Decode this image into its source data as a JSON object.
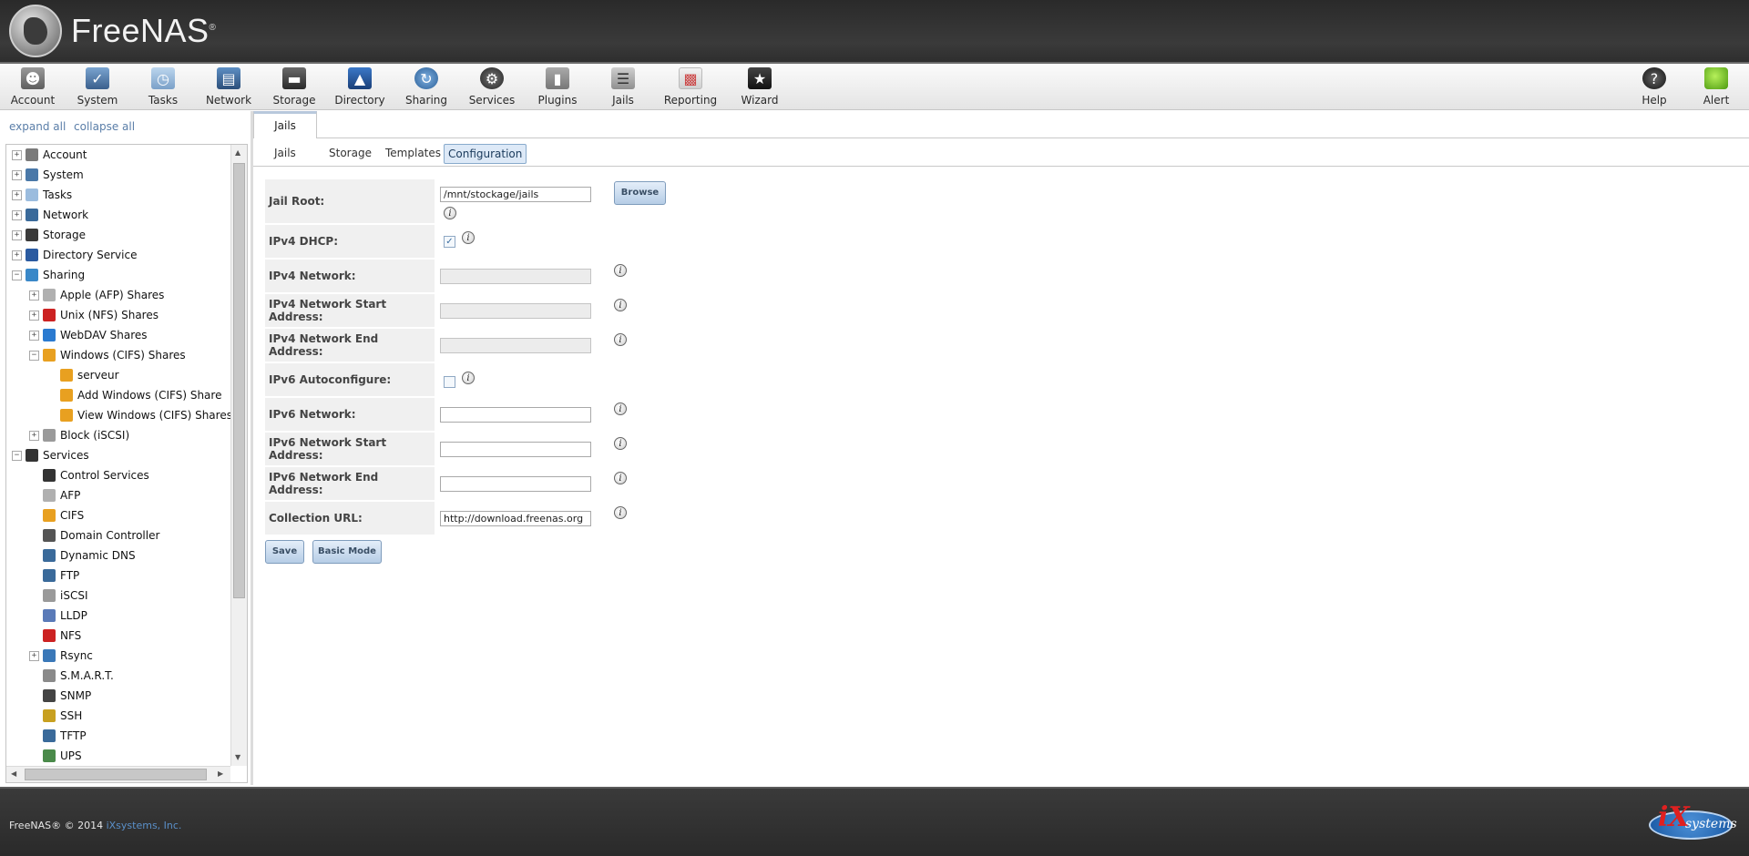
{
  "brand": {
    "name": "FreeNAS",
    "reg": "®"
  },
  "toolbar": {
    "items": [
      {
        "label": "Account",
        "icon": "account-icon"
      },
      {
        "label": "System",
        "icon": "system-icon"
      },
      {
        "label": "Tasks",
        "icon": "tasks-icon"
      },
      {
        "label": "Network",
        "icon": "network-icon"
      },
      {
        "label": "Storage",
        "icon": "storage-icon"
      },
      {
        "label": "Directory",
        "icon": "directory-icon"
      },
      {
        "label": "Sharing",
        "icon": "sharing-icon"
      },
      {
        "label": "Services",
        "icon": "services-icon"
      },
      {
        "label": "Plugins",
        "icon": "plugins-icon"
      },
      {
        "label": "Jails",
        "icon": "jails-icon"
      },
      {
        "label": "Reporting",
        "icon": "reporting-icon"
      },
      {
        "label": "Wizard",
        "icon": "wizard-icon"
      }
    ],
    "right": [
      {
        "label": "Help",
        "icon": "help-icon"
      },
      {
        "label": "Alert",
        "icon": "alert-icon"
      }
    ]
  },
  "tree_controls": {
    "expand": "expand all",
    "collapse": "collapse all"
  },
  "tree": [
    {
      "label": "Account",
      "level": 0,
      "toggle": "+",
      "icon": "account-icon"
    },
    {
      "label": "System",
      "level": 0,
      "toggle": "+",
      "icon": "system-icon"
    },
    {
      "label": "Tasks",
      "level": 0,
      "toggle": "+",
      "icon": "tasks-icon"
    },
    {
      "label": "Network",
      "level": 0,
      "toggle": "+",
      "icon": "network-icon"
    },
    {
      "label": "Storage",
      "level": 0,
      "toggle": "+",
      "icon": "storage-icon"
    },
    {
      "label": "Directory Service",
      "level": 0,
      "toggle": "+",
      "icon": "directory-icon"
    },
    {
      "label": "Sharing",
      "level": 0,
      "toggle": "−",
      "icon": "sharing-icon"
    },
    {
      "label": "Apple (AFP) Shares",
      "level": 1,
      "toggle": "+",
      "icon": "apple-icon"
    },
    {
      "label": "Unix (NFS) Shares",
      "level": 1,
      "toggle": "+",
      "icon": "nfs-icon"
    },
    {
      "label": "WebDAV Shares",
      "level": 1,
      "toggle": "+",
      "icon": "webdav-icon"
    },
    {
      "label": "Windows (CIFS) Shares",
      "level": 1,
      "toggle": "−",
      "icon": "windows-icon"
    },
    {
      "label": "serveur",
      "level": 2,
      "toggle": "",
      "icon": "windows-icon"
    },
    {
      "label": "Add Windows (CIFS) Share",
      "level": 2,
      "toggle": "",
      "icon": "add-share-icon"
    },
    {
      "label": "View Windows (CIFS) Shares",
      "level": 2,
      "toggle": "",
      "icon": "view-shares-icon"
    },
    {
      "label": "Block (iSCSI)",
      "level": 1,
      "toggle": "+",
      "icon": "block-icon"
    },
    {
      "label": "Services",
      "level": 0,
      "toggle": "−",
      "icon": "services-icon"
    },
    {
      "label": "Control Services",
      "level": 1,
      "toggle": "",
      "icon": "services-icon"
    },
    {
      "label": "AFP",
      "level": 1,
      "toggle": "",
      "icon": "apple-icon"
    },
    {
      "label": "CIFS",
      "level": 1,
      "toggle": "",
      "icon": "windows-icon"
    },
    {
      "label": "Domain Controller",
      "level": 1,
      "toggle": "",
      "icon": "domain-controller-icon"
    },
    {
      "label": "Dynamic DNS",
      "level": 1,
      "toggle": "",
      "icon": "network-icon"
    },
    {
      "label": "FTP",
      "level": 1,
      "toggle": "",
      "icon": "ftp-icon"
    },
    {
      "label": "iSCSI",
      "level": 1,
      "toggle": "",
      "icon": "block-icon"
    },
    {
      "label": "LLDP",
      "level": 1,
      "toggle": "",
      "icon": "lldp-icon"
    },
    {
      "label": "NFS",
      "level": 1,
      "toggle": "",
      "icon": "nfs-icon"
    },
    {
      "label": "Rsync",
      "level": 1,
      "toggle": "+",
      "icon": "rsync-icon"
    },
    {
      "label": "S.M.A.R.T.",
      "level": 1,
      "toggle": "",
      "icon": "smart-icon"
    },
    {
      "label": "SNMP",
      "level": 1,
      "toggle": "",
      "icon": "snmp-icon"
    },
    {
      "label": "SSH",
      "level": 1,
      "toggle": "",
      "icon": "ssh-icon"
    },
    {
      "label": "TFTP",
      "level": 1,
      "toggle": "",
      "icon": "tftp-icon"
    },
    {
      "label": "UPS",
      "level": 1,
      "toggle": "",
      "icon": "ups-icon"
    }
  ],
  "main": {
    "top_tab": "Jails",
    "subtabs": [
      "Jails",
      "Storage",
      "Templates",
      "Configuration"
    ],
    "active_subtab": "Configuration",
    "form": {
      "jail_root": {
        "label": "Jail Root:",
        "value": "/mnt/stockage/jails",
        "browse": "Browse"
      },
      "ipv4_dhcp": {
        "label": "IPv4 DHCP:",
        "checked": true
      },
      "ipv4_network": {
        "label": "IPv4 Network:",
        "value": ""
      },
      "ipv4_start": {
        "label": "IPv4 Network Start Address:",
        "value": ""
      },
      "ipv4_end": {
        "label": "IPv4 Network End Address:",
        "value": ""
      },
      "ipv6_auto": {
        "label": "IPv6 Autoconfigure:",
        "checked": false
      },
      "ipv6_network": {
        "label": "IPv6 Network:",
        "value": ""
      },
      "ipv6_start": {
        "label": "IPv6 Network Start Address:",
        "value": ""
      },
      "ipv6_end": {
        "label": "IPv6 Network End Address:",
        "value": ""
      },
      "collection_url": {
        "label": "Collection URL:",
        "value": "http://download.freenas.org"
      },
      "save": "Save",
      "basic_mode": "Basic Mode"
    }
  },
  "footer": {
    "copyright": "FreeNAS® © 2014",
    "company": "iXsystems, Inc.",
    "logo_ix": "iX",
    "logo_systems": "systems"
  },
  "colors": {
    "link": "#5a7ea8",
    "active_tab_bg": "#dde9f7",
    "header_bg": "#2e2e2e"
  }
}
